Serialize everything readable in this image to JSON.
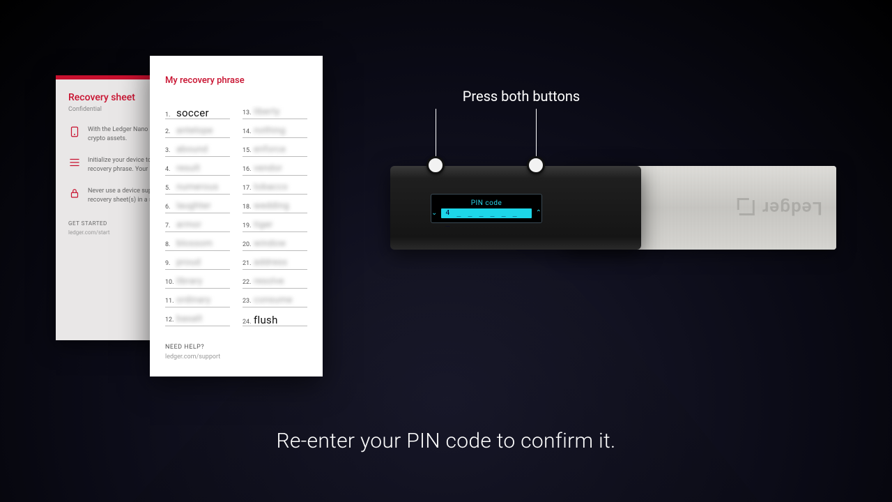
{
  "callout": {
    "text": "Press both buttons"
  },
  "caption": "Re-enter your PIN code to confirm it.",
  "device": {
    "screen_title": "PIN code",
    "pin_display": "4 _ _ _ _ _ _ _",
    "brand": "Ledger"
  },
  "recovery_sheet": {
    "title": "Recovery sheet",
    "subtitle": "Confidential",
    "bullets": [
      "With the Ledger Nano private keys to secure crypto assets.",
      "Initialize your device to and save your confide recovery phrase. Your is the only backup of y",
      "Never use a device sup code or a recovery phr recovery sheet(s) in a s"
    ],
    "footer_label": "GET STARTED",
    "footer_url": "ledger.com/start"
  },
  "recovery_phrase": {
    "title": "My recovery phrase",
    "words_left": [
      {
        "n": "1.",
        "w": "soccer",
        "clear": true
      },
      {
        "n": "2.",
        "w": "antelope",
        "clear": false
      },
      {
        "n": "3.",
        "w": "abound",
        "clear": false
      },
      {
        "n": "4.",
        "w": "result",
        "clear": false
      },
      {
        "n": "5.",
        "w": "numerous",
        "clear": false
      },
      {
        "n": "6.",
        "w": "laughter",
        "clear": false
      },
      {
        "n": "7.",
        "w": "armor",
        "clear": false
      },
      {
        "n": "8.",
        "w": "blossom",
        "clear": false
      },
      {
        "n": "9.",
        "w": "proud",
        "clear": false
      },
      {
        "n": "10.",
        "w": "library",
        "clear": false
      },
      {
        "n": "11.",
        "w": "ordinary",
        "clear": false
      },
      {
        "n": "12.",
        "w": "basalt",
        "clear": false
      }
    ],
    "words_right": [
      {
        "n": "13.",
        "w": "liberty",
        "clear": false
      },
      {
        "n": "14.",
        "w": "nothing",
        "clear": false
      },
      {
        "n": "15.",
        "w": "enforce",
        "clear": false
      },
      {
        "n": "16.",
        "w": "vendor",
        "clear": false
      },
      {
        "n": "17.",
        "w": "tobacco",
        "clear": false
      },
      {
        "n": "18.",
        "w": "wedding",
        "clear": false
      },
      {
        "n": "19.",
        "w": "tiger",
        "clear": false
      },
      {
        "n": "20.",
        "w": "window",
        "clear": false
      },
      {
        "n": "21.",
        "w": "address",
        "clear": false
      },
      {
        "n": "22.",
        "w": "resolve",
        "clear": false
      },
      {
        "n": "23.",
        "w": "consume",
        "clear": false
      },
      {
        "n": "24.",
        "w": "flush",
        "clear": true
      }
    ],
    "footer_label": "NEED HELP?",
    "footer_url": "ledger.com/support"
  }
}
